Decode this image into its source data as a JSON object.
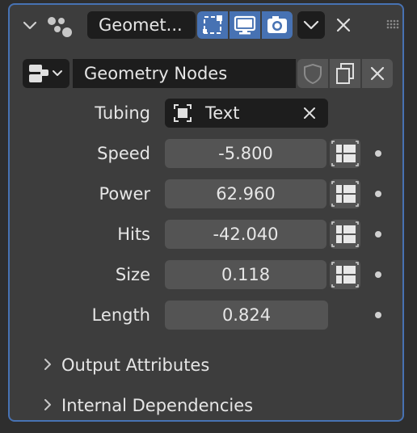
{
  "header": {
    "name_value": "Geomet...",
    "collapse_icon": "chevron-down-icon",
    "modifier_icon": "geometry-nodes-icon",
    "toggles": [
      {
        "icon": "edit-mode-icon"
      },
      {
        "icon": "viewport-display-icon"
      },
      {
        "icon": "render-camera-icon"
      }
    ],
    "dropdown_icon": "chevron-down-icon",
    "close_icon": "close-icon",
    "drag_icon": "drag-handle-icon"
  },
  "node_group": {
    "name": "Geometry Nodes",
    "browse_icon": "node-tree-icon",
    "fake_user_icon": "shield-icon",
    "duplicate_icon": "duplicate-icon",
    "unlink_icon": "close-icon"
  },
  "inputs": {
    "tubing": {
      "label": "Tubing",
      "value": "Text",
      "icon": "object-icon"
    },
    "speed": {
      "label": "Speed",
      "value": "-5.800"
    },
    "power": {
      "label": "Power",
      "value": "62.960"
    },
    "hits": {
      "label": "Hits",
      "value": "-42.040"
    },
    "size": {
      "label": "Size",
      "value": "0.118"
    },
    "length": {
      "label": "Length",
      "value": "0.824"
    }
  },
  "sections": [
    {
      "label": "Output Attributes"
    },
    {
      "label": "Internal Dependencies"
    }
  ],
  "colors": {
    "accent": "#4772b3",
    "panel": "#3d3d3d",
    "field": "#545454",
    "dark_field": "#1d1d1d",
    "text": "#e6e6e6"
  }
}
